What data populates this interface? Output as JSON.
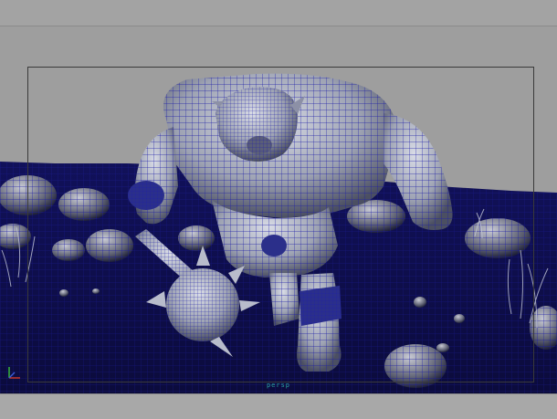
{
  "viewport": {
    "camera_name": "persp",
    "mode": "wireframe-on-shaded",
    "wire_color": "#1f1fa8",
    "shade_color": "#c9ccd6",
    "background_color": "#9e9e9e"
  },
  "axis": {
    "x_color": "#d33b2b",
    "y_color": "#3cbf3c",
    "z_color": "#3b5bd6"
  },
  "icons": [
    "axis-gizmo-icon"
  ]
}
